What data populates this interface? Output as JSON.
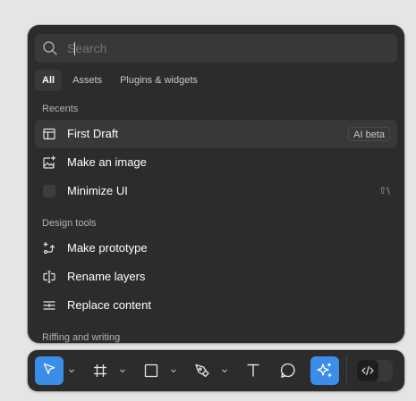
{
  "search": {
    "placeholder": "Search",
    "value": ""
  },
  "tabs": [
    {
      "label": "All",
      "active": true
    },
    {
      "label": "Assets",
      "active": false
    },
    {
      "label": "Plugins & widgets",
      "active": false
    }
  ],
  "sections": {
    "recents": {
      "title": "Recents",
      "items": [
        {
          "label": "First Draft",
          "icon": "layout-icon",
          "badge": "AI beta"
        },
        {
          "label": "Make an image",
          "icon": "image-sparkle-icon"
        },
        {
          "label": "Minimize UI",
          "icon": "checkbox-icon",
          "shortcut": "⇧\\"
        }
      ]
    },
    "design_tools": {
      "title": "Design tools",
      "items": [
        {
          "label": "Make prototype",
          "icon": "prototype-sparkle-icon"
        },
        {
          "label": "Rename layers",
          "icon": "rename-layers-icon"
        },
        {
          "label": "Replace content",
          "icon": "replace-content-icon"
        }
      ]
    },
    "riffing": {
      "title": "Riffing and writing"
    }
  },
  "toolbar": {
    "tools": [
      {
        "name": "move-tool",
        "icon": "cursor-arrow-icon",
        "active": true,
        "has_menu": true
      },
      {
        "name": "frame-tool",
        "icon": "frame-hash-icon",
        "active": false,
        "has_menu": true
      },
      {
        "name": "shape-tool",
        "icon": "rectangle-icon",
        "active": false,
        "has_menu": true
      },
      {
        "name": "pen-tool",
        "icon": "pen-icon",
        "active": false,
        "has_menu": true
      },
      {
        "name": "text-tool",
        "icon": "text-t-icon",
        "active": false,
        "has_menu": false
      },
      {
        "name": "comment-tool",
        "icon": "comment-bubble-icon",
        "active": false,
        "has_menu": false
      },
      {
        "name": "actions-tool",
        "icon": "ai-sparkle-icon",
        "active": true,
        "has_menu": false
      }
    ],
    "dev_mode_icon": "code-brackets-icon"
  },
  "colors": {
    "accent": "#3b8ee8",
    "panel_bg": "#2c2c2c",
    "row_highlight": "#383838",
    "canvas_bg": "#e5e5e5"
  }
}
